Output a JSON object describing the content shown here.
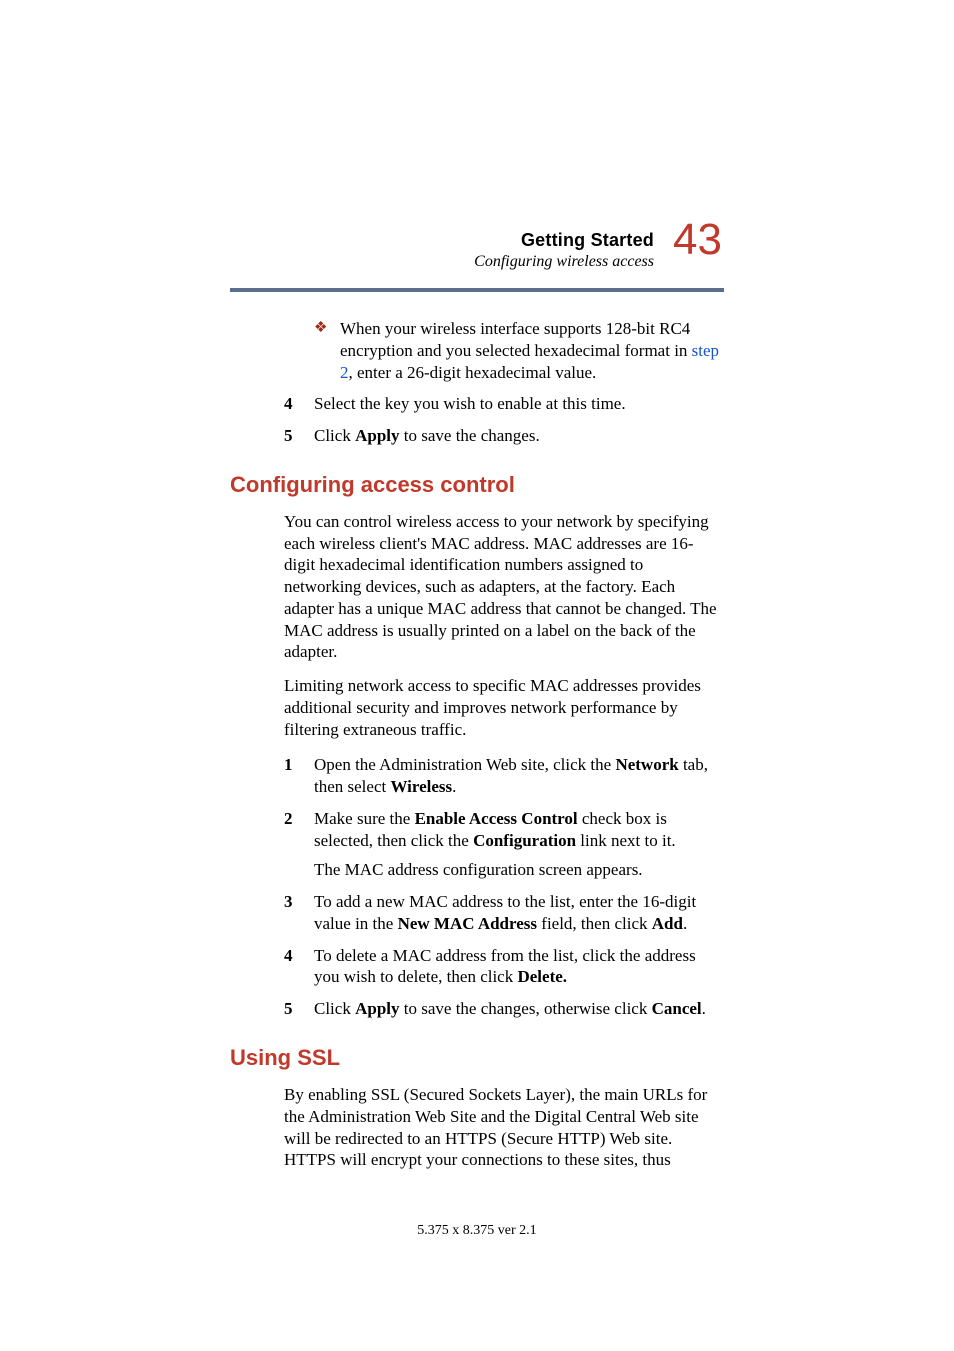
{
  "header": {
    "chapter": "Getting Started",
    "section": "Configuring wireless access",
    "page_number": "43"
  },
  "top_bullet": {
    "prefix": "When your wireless interface supports 128-bit RC4 encryption and you selected hexadecimal format in ",
    "link": "step 2",
    "suffix": ", enter a 26-digit hexadecimal value."
  },
  "top_steps": {
    "s4": {
      "num": "4",
      "text": "Select the key you wish to enable at this time."
    },
    "s5": {
      "num": "5",
      "pre": "Click ",
      "bold": "Apply",
      "post": " to save the changes."
    }
  },
  "h_access": "Configuring access control",
  "access_para1": "You can control wireless access to your network by specifying each wireless client's MAC address. MAC addresses are 16-digit hexadecimal identification numbers assigned to networking devices, such as adapters, at the factory. Each adapter has a unique MAC address that cannot be changed. The MAC address is usually printed on a label on the back of the adapter.",
  "access_para2": "Limiting network access to specific MAC addresses provides additional security and improves network performance by filtering extraneous traffic.",
  "access_steps": {
    "s1": {
      "num": "1",
      "a": "Open the Administration Web site, click the ",
      "b1": "Network",
      "c": " tab, then select ",
      "b2": "Wireless",
      "d": "."
    },
    "s2": {
      "num": "2",
      "a": "Make sure the ",
      "b1": "Enable Access Control",
      "c": " check box is selected, then click the ",
      "b2": "Configuration",
      "d": " link next to it."
    },
    "s2_follow": "The MAC address configuration screen appears.",
    "s3": {
      "num": "3",
      "a": "To add a new MAC address to the list, enter the 16-digit value in the ",
      "b1": "New MAC Address",
      "c": " field, then click ",
      "b2": "Add",
      "d": "."
    },
    "s4": {
      "num": "4",
      "a": "To delete a MAC address from the list, click the address you wish to delete, then click ",
      "b1": "Delete.",
      "c": "",
      "b2": "",
      "d": ""
    },
    "s5": {
      "num": "5",
      "a": "Click ",
      "b1": "Apply",
      "c": " to save the changes, otherwise click ",
      "b2": "Cancel",
      "d": "."
    }
  },
  "h_ssl": "Using SSL",
  "ssl_para": "By enabling SSL (Secured Sockets Layer), the main URLs for the Administration Web Site and the Digital Central Web site will be redirected to an HTTPS (Secure HTTP) Web site. HTTPS will encrypt your connections to these sites, thus",
  "footer": "5.375 x 8.375 ver 2.1"
}
